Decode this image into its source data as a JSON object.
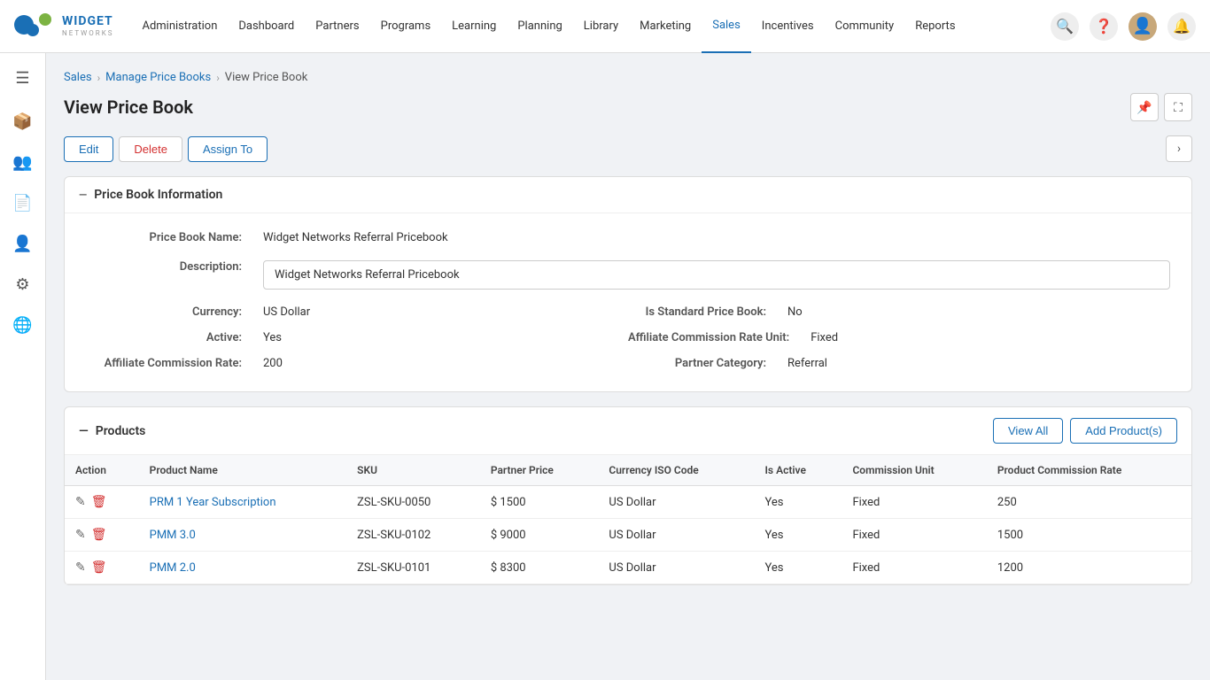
{
  "app": {
    "logo_name": "WIDGET",
    "logo_sub": "NETWORKS"
  },
  "nav": {
    "links": [
      {
        "label": "Administration",
        "active": false
      },
      {
        "label": "Dashboard",
        "active": false
      },
      {
        "label": "Partners",
        "active": false
      },
      {
        "label": "Programs",
        "active": false
      },
      {
        "label": "Learning",
        "active": false
      },
      {
        "label": "Planning",
        "active": false
      },
      {
        "label": "Library",
        "active": false
      },
      {
        "label": "Marketing",
        "active": false
      },
      {
        "label": "Sales",
        "active": true
      },
      {
        "label": "Incentives",
        "active": false
      },
      {
        "label": "Community",
        "active": false
      },
      {
        "label": "Reports",
        "active": false
      }
    ]
  },
  "breadcrumb": {
    "items": [
      {
        "label": "Sales",
        "link": true
      },
      {
        "label": "Manage Price Books",
        "link": true
      },
      {
        "label": "View Price Book",
        "link": false
      }
    ]
  },
  "page": {
    "title": "View Price Book"
  },
  "buttons": {
    "edit": "Edit",
    "delete": "Delete",
    "assign_to": "Assign To",
    "view_all": "View All",
    "add_product": "Add Product(s)"
  },
  "sections": {
    "price_book_info": {
      "header": "Price Book Information",
      "fields": {
        "price_book_name_label": "Price Book Name:",
        "price_book_name_value": "Widget Networks Referral Pricebook",
        "description_label": "Description:",
        "description_value": "Widget Networks Referral Pricebook",
        "currency_label": "Currency:",
        "currency_value": "US Dollar",
        "is_standard_label": "Is Standard Price Book:",
        "is_standard_value": "No",
        "active_label": "Active:",
        "active_value": "Yes",
        "commission_rate_unit_label": "Affiliate Commission Rate Unit:",
        "commission_rate_unit_value": "Fixed",
        "affiliate_commission_label": "Affiliate Commission Rate:",
        "affiliate_commission_value": "200",
        "partner_category_label": "Partner Category:",
        "partner_category_value": "Referral"
      }
    },
    "products": {
      "header": "Products",
      "columns": [
        {
          "key": "action",
          "label": "Action"
        },
        {
          "key": "product_name",
          "label": "Product Name"
        },
        {
          "key": "sku",
          "label": "SKU"
        },
        {
          "key": "partner_price",
          "label": "Partner Price"
        },
        {
          "key": "currency_iso",
          "label": "Currency ISO Code"
        },
        {
          "key": "is_active",
          "label": "Is Active"
        },
        {
          "key": "commission_unit",
          "label": "Commission Unit"
        },
        {
          "key": "product_commission_rate",
          "label": "Product Commission Rate"
        }
      ],
      "rows": [
        {
          "product_name": "PRM 1 Year Subscription",
          "sku": "ZSL-SKU-0050",
          "partner_price": "$ 1500",
          "currency_iso": "US Dollar",
          "is_active": "Yes",
          "commission_unit": "Fixed",
          "product_commission_rate": "250"
        },
        {
          "product_name": "PMM 3.0",
          "sku": "ZSL-SKU-0102",
          "partner_price": "$ 9000",
          "currency_iso": "US Dollar",
          "is_active": "Yes",
          "commission_unit": "Fixed",
          "product_commission_rate": "1500"
        },
        {
          "product_name": "PMM 2.0",
          "sku": "ZSL-SKU-0101",
          "partner_price": "$ 8300",
          "currency_iso": "US Dollar",
          "is_active": "Yes",
          "commission_unit": "Fixed",
          "product_commission_rate": "1200"
        }
      ]
    }
  }
}
